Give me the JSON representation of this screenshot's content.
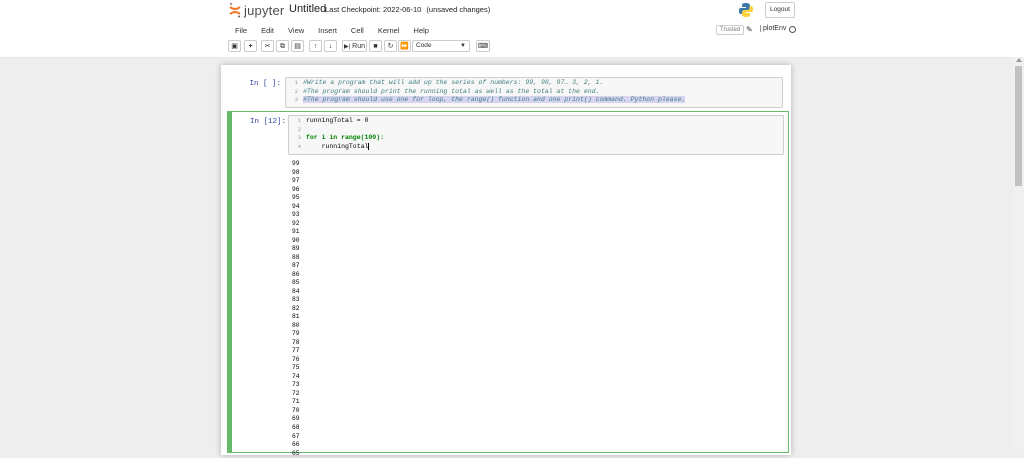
{
  "header": {
    "logo_text": "jupyter",
    "notebook_title": "Untitled",
    "checkpoint_label": "Last Checkpoint: 2022-06-10",
    "unsaved": "(unsaved changes)",
    "logout_label": "Logout"
  },
  "menu": [
    "File",
    "Edit",
    "View",
    "Insert",
    "Cell",
    "Kernel",
    "Help"
  ],
  "status": {
    "trusted_label": "Trusted",
    "kernel_name": "plotEnv"
  },
  "toolbar": {
    "run_label": "Run",
    "cell_type": "Code"
  },
  "cells": [
    {
      "prompt": "In [ ]:",
      "lines": [
        "#Write a program that will add up the series of numbers: 99, 98, 97… 3, 2, 1.",
        "#The program should print the running total as well as the total at the end.",
        "#The program should use one for loop, the range() function and one print() command. Python please."
      ]
    },
    {
      "prompt": "In [12]:",
      "lines": [
        "runningTotal = 0",
        "",
        "for i in range(100):",
        "    runningTotal"
      ],
      "outputs": [
        "99",
        "98",
        "97",
        "96",
        "95",
        "94",
        "93",
        "92",
        "91",
        "90",
        "89",
        "88",
        "87",
        "86",
        "85",
        "84",
        "83",
        "82",
        "81",
        "80",
        "79",
        "78",
        "77",
        "76",
        "75",
        "74",
        "73",
        "72",
        "71",
        "70",
        "69",
        "68",
        "67",
        "66",
        "65"
      ]
    }
  ],
  "colors": {
    "selected_cell_border": "#66bb6a",
    "prompt_color": "#303f9f",
    "comment_color": "#408080"
  }
}
